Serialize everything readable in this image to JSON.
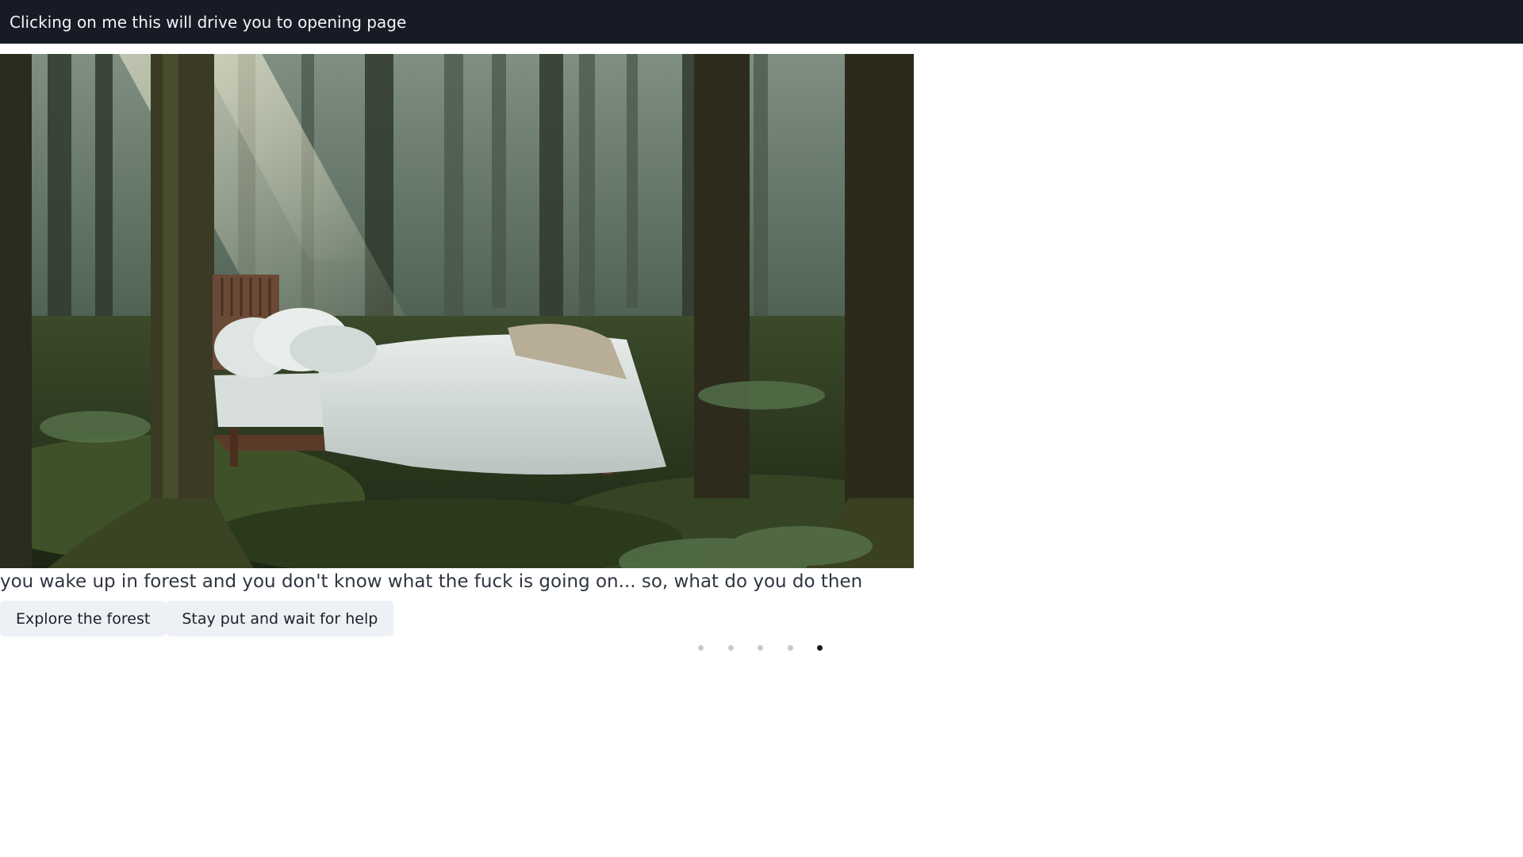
{
  "header": {
    "link_label": "Clicking on me this will drive you to opening page"
  },
  "scene": {
    "image_description_icon": "forest-bed-image"
  },
  "story": {
    "text": "you wake up in forest and you don't know what the fuck is going on... so, what do you do then"
  },
  "choices": [
    {
      "label": "Explore the forest"
    },
    {
      "label": "Stay put and wait for help"
    }
  ],
  "pagination": {
    "count": 5,
    "active_index": 4
  },
  "colors": {
    "topbar": "#171b26",
    "button_bg": "#edf1f5",
    "dot_inactive": "#c9c9c9",
    "dot_active": "#1a1a1a"
  }
}
